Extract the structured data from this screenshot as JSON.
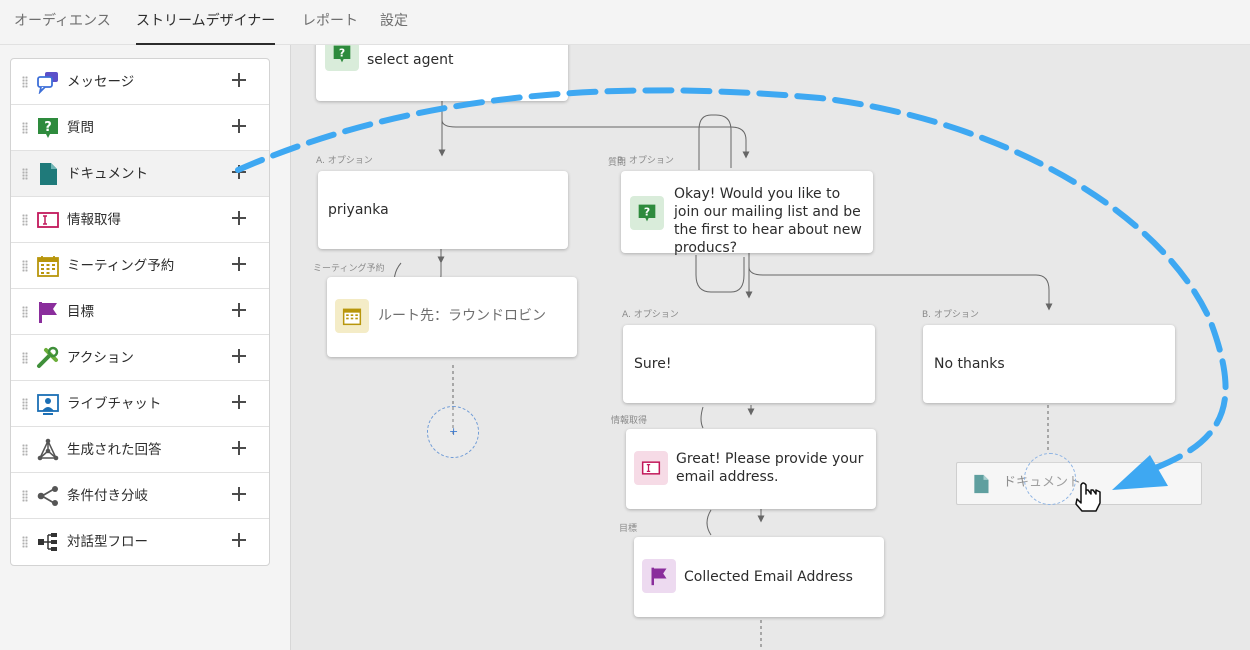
{
  "nav": {
    "tabs": [
      {
        "label": "オーディエンス",
        "active": false
      },
      {
        "label": "ストリームデザイナー",
        "active": true
      },
      {
        "label": "レポート",
        "active": false
      },
      {
        "label": "設定",
        "active": false
      }
    ]
  },
  "sidebar": {
    "items": [
      {
        "label": "メッセージ",
        "icon": "chat-bubbles-icon"
      },
      {
        "label": "質問",
        "icon": "question-icon"
      },
      {
        "label": "ドキュメント",
        "icon": "document-icon"
      },
      {
        "label": "情報取得",
        "icon": "text-field-icon"
      },
      {
        "label": "ミーティング予約",
        "icon": "calendar-icon"
      },
      {
        "label": "目標",
        "icon": "flag-icon"
      },
      {
        "label": "アクション",
        "icon": "tools-icon"
      },
      {
        "label": "ライブチャット",
        "icon": "live-chat-icon"
      },
      {
        "label": "生成された回答",
        "icon": "network-icon"
      },
      {
        "label": "条件付き分岐",
        "icon": "share-branch-icon"
      },
      {
        "label": "対話型フロー",
        "icon": "flow-icon"
      }
    ]
  },
  "canvas": {
    "select_agent": "select agent",
    "option_a_left_tag": "A. オプション",
    "option_a_left": "priyanka",
    "meeting_tag": "ミーティング予約",
    "meeting_label": "ルート先：ラウンドロビン",
    "question_tag": "質問",
    "question_option_tag": "B. オプション",
    "question_text": "Okay! Would you like to join our mailing list and be the first to hear about new producs?",
    "option_a_tag": "A. オプション",
    "option_a_text": "Sure!",
    "option_b_tag": "B. オプション",
    "option_b_text": "No thanks",
    "capture_tag": "情報取得",
    "capture_text": "Great! Please provide your email address.",
    "goal_tag": "目標",
    "goal_text": "Collected Email Address",
    "drop_label": "ドキュメント",
    "add_symbol": "+"
  },
  "colors": {
    "accent_blue": "#3ea8f2",
    "question_green": "#2e8b3d",
    "document_teal": "#1f7a7a",
    "goal_purple": "#8a2d9c",
    "capture_pink": "#c2185b",
    "calendar_gold": "#b8960c"
  }
}
